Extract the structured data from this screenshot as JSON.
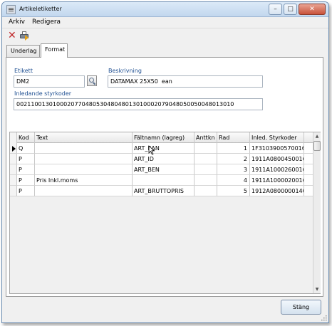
{
  "window": {
    "title": "Artikeletiketter"
  },
  "menu": {
    "items": [
      {
        "label": "Arkiv"
      },
      {
        "label": "Redigera"
      }
    ]
  },
  "toolbar": {
    "icons": [
      "delete-icon",
      "print-icon"
    ]
  },
  "tabs": [
    {
      "label": "Underlag",
      "active": false
    },
    {
      "label": "Format",
      "active": true
    }
  ],
  "form": {
    "etikett": {
      "label": "Etikett",
      "value": "DM2"
    },
    "beskrivning": {
      "label": "Beskrivning",
      "value": "DATAMAX 25X50  ean"
    },
    "inledande_styrkoder": {
      "label": "Inledande styrkoder",
      "value": "002110013010002077048053048048013010002079048050050048013010"
    }
  },
  "grid": {
    "columns": [
      "Kod",
      "Text",
      "Fältnamn (lagreg)",
      "Anttkn",
      "Rad",
      "Inled. Styrkoder"
    ],
    "rows": [
      {
        "kod": "Q",
        "text": "",
        "faltnamn": "ART_EAN",
        "anttkn": "",
        "rad": "1",
        "inled": "1F3103900570016",
        "current": true
      },
      {
        "kod": "P",
        "text": "",
        "faltnamn": "ART_ID",
        "anttkn": "",
        "rad": "2",
        "inled": "1911A0800450016",
        "current": false
      },
      {
        "kod": "P",
        "text": "",
        "faltnamn": "ART_BEN",
        "anttkn": "",
        "rad": "3",
        "inled": "1911A1000260016",
        "current": false
      },
      {
        "kod": "P",
        "text": "Pris Inkl.moms",
        "faltnamn": "",
        "anttkn": "",
        "rad": "4",
        "inled": "1911A1000020016",
        "current": false
      },
      {
        "kod": "P",
        "text": "",
        "faltnamn": "ART_BRUTTOPRIS",
        "anttkn": "",
        "rad": "5",
        "inled": "1912A0800000140",
        "current": false
      }
    ]
  },
  "buttons": {
    "close_label": "Stäng"
  },
  "colors": {
    "label_blue": "#1e4f92",
    "delete_red": "#c0282a"
  }
}
